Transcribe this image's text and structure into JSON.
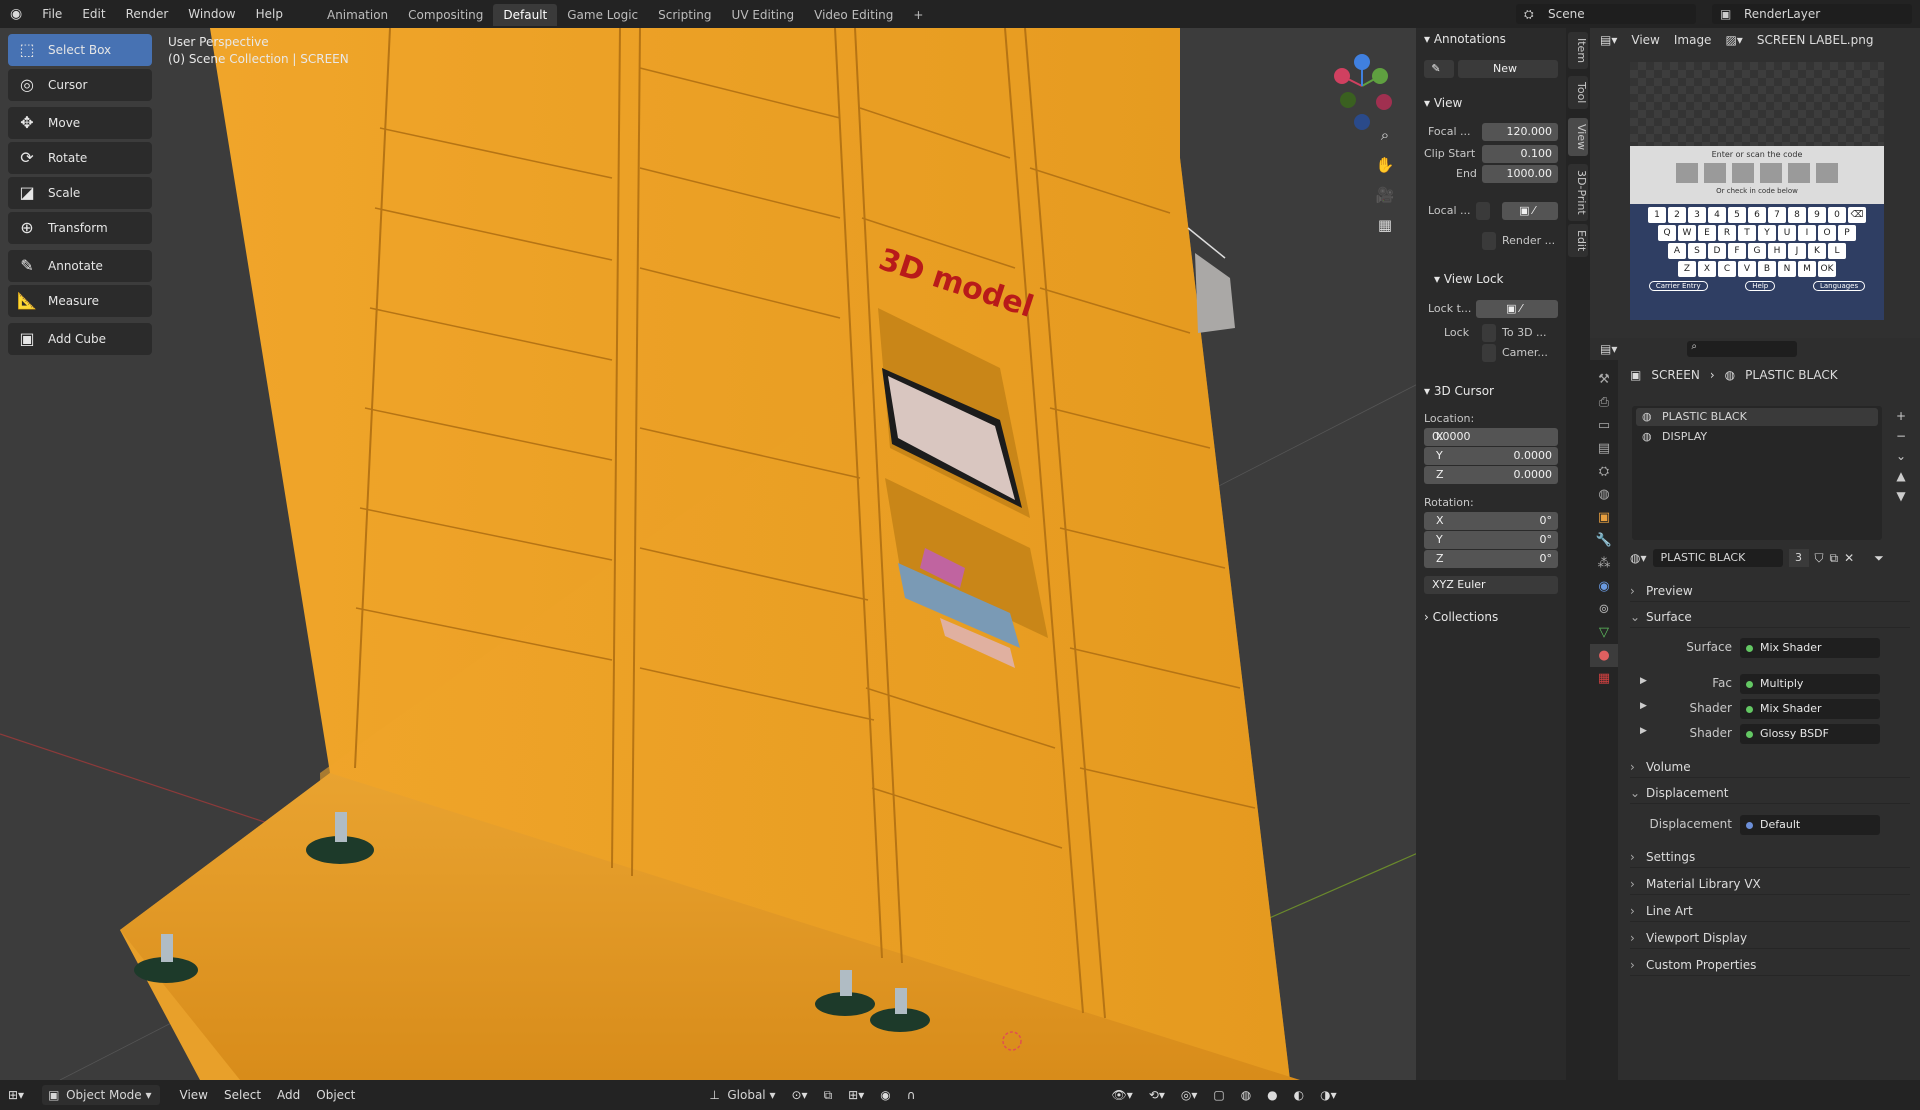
{
  "menu": {
    "file": "File",
    "edit": "Edit",
    "render": "Render",
    "window": "Window",
    "help": "Help"
  },
  "workspaces": [
    "Animation",
    "Compositing",
    "Default",
    "Game Logic",
    "Scripting",
    "UV Editing",
    "Video Editing"
  ],
  "active_workspace": "Default",
  "scene": {
    "name": "Scene",
    "render_layer": "RenderLayer"
  },
  "tools": [
    "Select Box",
    "Cursor",
    "Move",
    "Rotate",
    "Scale",
    "Transform",
    "Annotate",
    "Measure",
    "Add Cube"
  ],
  "viewport": {
    "perspective": "User Perspective",
    "collection": "(0) Scene Collection | SCREEN",
    "model_label": "3D model"
  },
  "npanel": {
    "annotations": "Annotations",
    "new_label": "New",
    "view": "View",
    "focal_label": "Focal ...",
    "focal": "120.000",
    "clip_start_label": "Clip Start",
    "clip_start": "0.100",
    "end_label": "End",
    "end": "1000.00",
    "local_label": "Local ...",
    "render_label": "Render ...",
    "view_lock": "View Lock",
    "lock_to_label": "Lock t...",
    "lock_label": "Lock",
    "to_3d": "To 3D ...",
    "camera": "Camer...",
    "cursor": "3D Cursor",
    "location": "Location:",
    "rotation": "Rotation:",
    "loc": [
      {
        "axis": "X",
        "val": "0.0000"
      },
      {
        "axis": "Y",
        "val": "0.0000"
      },
      {
        "axis": "Z",
        "val": "0.0000"
      }
    ],
    "rot": [
      {
        "axis": "X",
        "val": "0°"
      },
      {
        "axis": "Y",
        "val": "0°"
      },
      {
        "axis": "Z",
        "val": "0°"
      }
    ],
    "euler": "XYZ Euler",
    "collections": "Collections",
    "tabs": [
      "Item",
      "Tool",
      "View",
      "3D-Print",
      "Edit"
    ]
  },
  "image_editor": {
    "view": "View",
    "image": "Image",
    "filename": "SCREEN LABEL.png",
    "scan_text": "Enter or scan the code",
    "check_text": "Or check in code below",
    "keys_row1": [
      "1",
      "2",
      "3",
      "4",
      "5",
      "6",
      "7",
      "8",
      "9",
      "0",
      "⌫"
    ],
    "keys_row2": [
      "Q",
      "W",
      "E",
      "R",
      "T",
      "Y",
      "U",
      "I",
      "O",
      "P"
    ],
    "keys_row3": [
      "A",
      "S",
      "D",
      "F",
      "G",
      "H",
      "J",
      "K",
      "L"
    ],
    "keys_row4": [
      "Z",
      "X",
      "C",
      "V",
      "B",
      "N",
      "M",
      "OK"
    ],
    "btn_carrier": "Carrier Entry",
    "btn_help": "Help",
    "btn_lang": "Languages"
  },
  "properties": {
    "breadcrumb_obj": "SCREEN",
    "breadcrumb_mat": "PLASTIC BLACK",
    "slots": [
      "PLASTIC BLACK",
      "DISPLAY"
    ],
    "material_name": "PLASTIC BLACK",
    "users": "3",
    "preview": "Preview",
    "surface": "Surface",
    "surface_label": "Surface",
    "surface_val": "Mix Shader",
    "fac_label": "Fac",
    "fac_val": "Multiply",
    "shader1_label": "Shader",
    "shader1_val": "Mix Shader",
    "shader2_label": "Shader",
    "shader2_val": "Glossy BSDF",
    "volume": "Volume",
    "displacement": "Displacement",
    "disp_label": "Displacement",
    "disp_val": "Default",
    "settings": "Settings",
    "mat_lib": "Material Library VX",
    "line_art": "Line Art",
    "viewport_display": "Viewport Display",
    "custom_props": "Custom Properties"
  },
  "status": {
    "mode": "Object Mode",
    "view": "View",
    "select": "Select",
    "add": "Add",
    "object": "Object",
    "orientation": "Global"
  }
}
